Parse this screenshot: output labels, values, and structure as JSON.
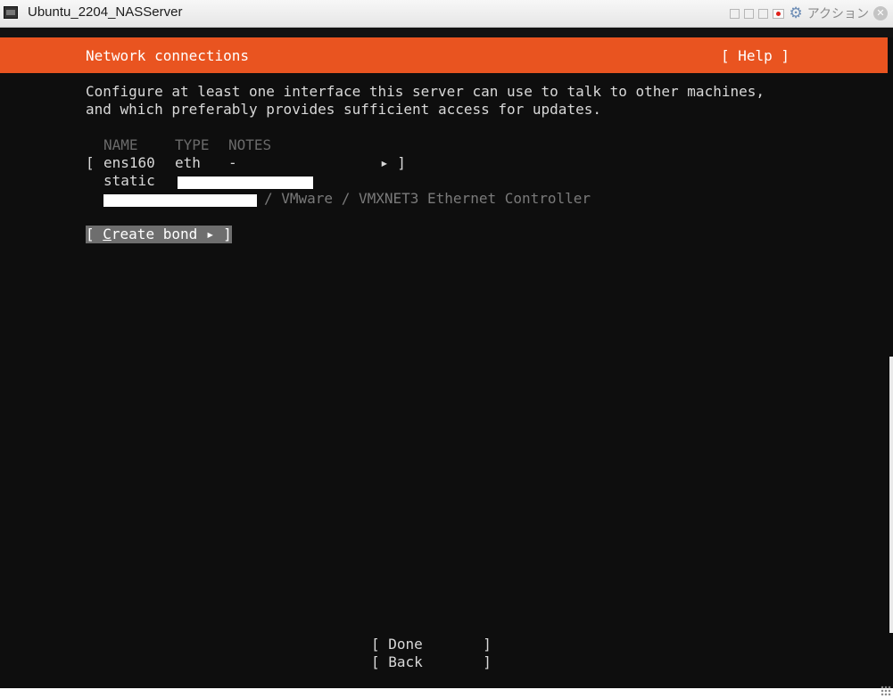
{
  "window": {
    "title": "Ubuntu_2204_NASServer",
    "action_label": "アクション",
    "close_glyph": "✕",
    "gear_glyph": "⚙"
  },
  "header": {
    "title": "Network connections",
    "help": "[ Help ]",
    "accent_color": "#e95420"
  },
  "description": {
    "line1": "Configure at least one interface this server can use to talk to other machines,",
    "line2": "and which preferably provides sufficient access for updates."
  },
  "table": {
    "col_name": "NAME",
    "col_type": "TYPE",
    "col_notes": "NOTES",
    "row": {
      "bracket_open": "[",
      "name": "ens160",
      "type": "eth",
      "notes": "-",
      "arrow_close": "▸ ]",
      "method": "static",
      "device_info": "/ VMware / VMXNET3 Ethernet Controller"
    }
  },
  "create_bond": {
    "prefix": "[ ",
    "hotkey": "C",
    "rest": "reate bond ▸ ]"
  },
  "footer": {
    "done": "[ Done       ]",
    "back": "[ Back       ]"
  }
}
